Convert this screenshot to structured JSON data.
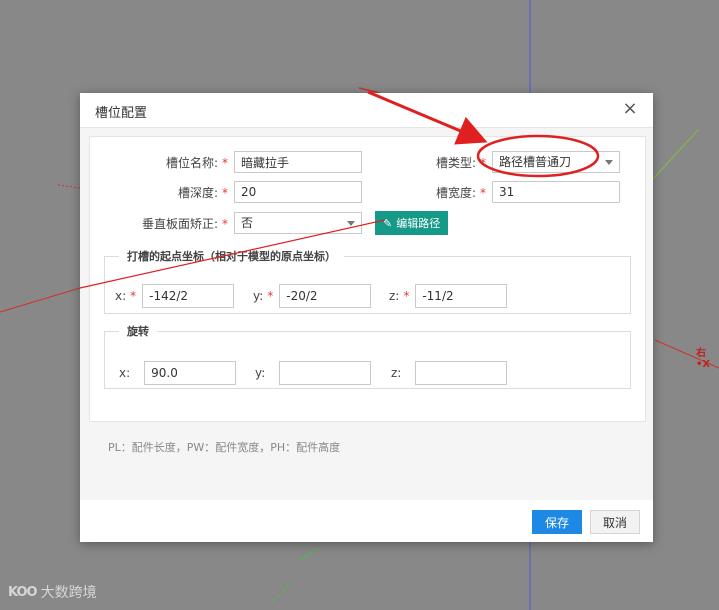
{
  "dialog": {
    "title": "槽位配置",
    "close_icon": "×"
  },
  "form": {
    "slot_name": {
      "label": "槽位名称:",
      "value": "暗藏拉手",
      "required": "*"
    },
    "slot_type": {
      "label": "槽类型:",
      "selected": "路径槽普通刀",
      "required": "*"
    },
    "slot_depth": {
      "label": "槽深度:",
      "value": "20",
      "required": "*"
    },
    "slot_width": {
      "label": "槽宽度:",
      "value": "31",
      "required": "*"
    },
    "vertical_correction": {
      "label": "垂直板面矫正:",
      "selected": "否",
      "required": "*"
    },
    "edit_path_button": "编辑路径"
  },
  "start_point": {
    "legend": "打槽的起点坐标（相对于模型的原点坐标）",
    "x": {
      "label": "x:",
      "value": "-142/2",
      "required": "*"
    },
    "y": {
      "label": "y:",
      "value": "-20/2",
      "required": "*"
    },
    "z": {
      "label": "z:",
      "value": "-11/2",
      "required": "*"
    }
  },
  "rotation": {
    "legend": "旋转",
    "x": {
      "label": "x:",
      "value": "90.0"
    },
    "y": {
      "label": "y:",
      "value": ""
    },
    "z": {
      "label": "z:",
      "value": ""
    }
  },
  "hint": "PL：配件长度，PW：配件宽度，PH：配件高度",
  "footer": {
    "save": "保存",
    "cancel": "取消"
  },
  "background": {
    "axis_label": "右 •X",
    "watermark_logo": "KOO",
    "watermark_text": "大数跨境"
  },
  "colors": {
    "primary_button": "#1e88e5",
    "edit_button": "#149a87",
    "required_mark": "#e4393c",
    "annotation_red": "#e02020"
  }
}
